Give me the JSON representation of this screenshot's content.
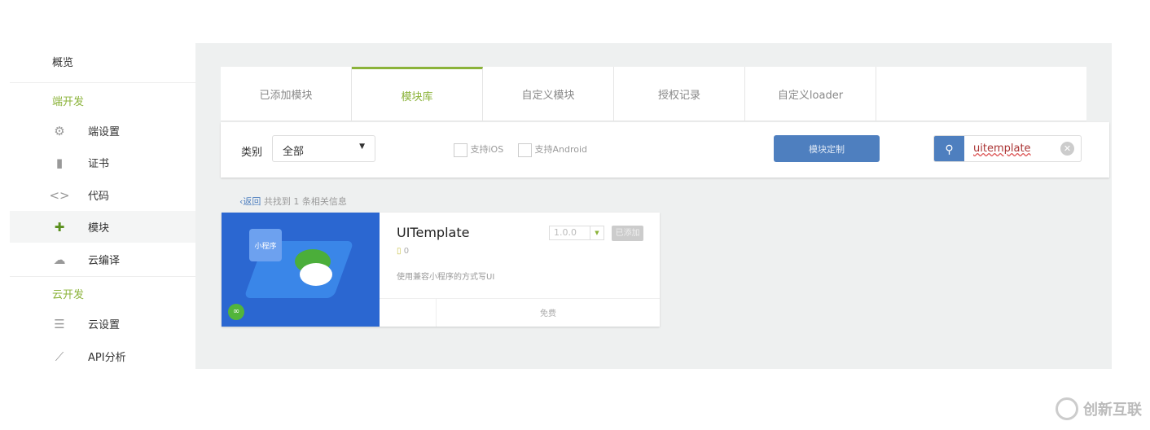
{
  "sidebar": {
    "overview": "概览",
    "section_client": "端开发",
    "items": [
      {
        "label": "端设置",
        "icon": "gear-icon"
      },
      {
        "label": "证书",
        "icon": "certificate-icon"
      },
      {
        "label": "代码",
        "icon": "code-icon"
      },
      {
        "label": "模块",
        "icon": "puzzle-icon"
      },
      {
        "label": "云编译",
        "icon": "cloud-icon"
      }
    ],
    "section_cloud": "云开发",
    "cloud_items": [
      {
        "label": "云设置",
        "icon": "sliders-icon"
      },
      {
        "label": "API分析",
        "icon": "chart-icon"
      }
    ]
  },
  "tabs": [
    "已添加模块",
    "模块库",
    "自定义模块",
    "授权记录",
    "自定义loader"
  ],
  "active_tab": "模块库",
  "filter": {
    "category_label": "类别",
    "category_value": "全部",
    "ios_label": "支持iOS",
    "android_label": "支持Android",
    "custom_button": "模块定制",
    "search_value": "uitemplate"
  },
  "results": {
    "back": "返回",
    "summary": "共找到 1 条相关信息"
  },
  "module": {
    "name": "UITemplate",
    "downloads": "0",
    "description": "使用兼容小程序的方式写UI",
    "version": "1.0.0",
    "status": "已添加",
    "price": "免费",
    "image_text": "小程序"
  },
  "watermark": "创新互联",
  "colors": {
    "accent": "#8bb33a",
    "primary": "#4e7fbf"
  }
}
